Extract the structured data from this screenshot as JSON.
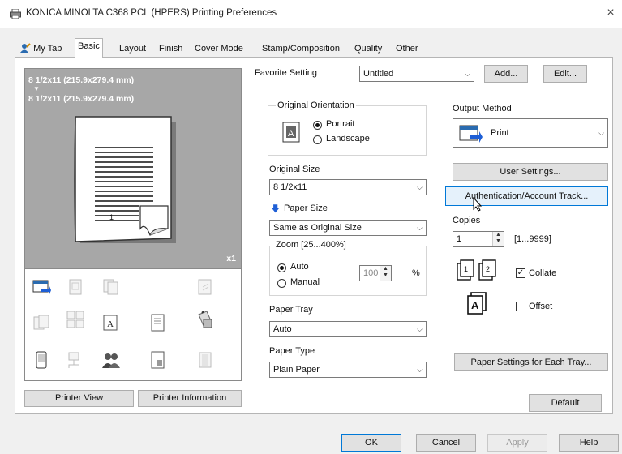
{
  "window": {
    "title": "KONICA MINOLTA C368 PCL (HPERS) Printing Preferences",
    "close": "×"
  },
  "tabs": [
    {
      "label": "My Tab"
    },
    {
      "label": "Basic"
    },
    {
      "label": "Layout"
    },
    {
      "label": "Finish"
    },
    {
      "label": "Cover Mode"
    },
    {
      "label": "Stamp/Composition"
    },
    {
      "label": "Quality"
    },
    {
      "label": "Other"
    }
  ],
  "preview": {
    "line1": "8 1/2x11 (215.9x279.4 mm)",
    "arrow": "▼",
    "line2": "8 1/2x11 (215.9x279.4 mm)",
    "page_count": "x1",
    "page_number": "1"
  },
  "left_buttons": {
    "printer_view": "Printer View",
    "printer_information": "Printer Information"
  },
  "favorite": {
    "label": "Favorite Setting",
    "value": "Untitled",
    "add": "Add...",
    "edit": "Edit..."
  },
  "orientation": {
    "group_label": "Original Orientation",
    "portrait": "Portrait",
    "landscape": "Landscape",
    "selected": "Portrait"
  },
  "original_size": {
    "label": "Original Size",
    "value": "8 1/2x11"
  },
  "paper_size": {
    "label": "Paper Size",
    "value": "Same as Original Size"
  },
  "zoom": {
    "group_label": "Zoom [25...400%]",
    "auto": "Auto",
    "manual": "Manual",
    "value": "100",
    "unit": "%",
    "selected": "Auto"
  },
  "paper_tray": {
    "label": "Paper Tray",
    "value": "Auto"
  },
  "paper_type": {
    "label": "Paper Type",
    "value": "Plain Paper"
  },
  "output": {
    "label": "Output Method",
    "value": "Print",
    "user_settings": "User Settings...",
    "auth": "Authentication/Account Track..."
  },
  "copies": {
    "label": "Copies",
    "value": "1",
    "range": "[1...9999]",
    "collate": "Collate",
    "collate_checked": true,
    "offset": "Offset",
    "offset_checked": false
  },
  "paper_settings_button": "Paper Settings for Each Tray...",
  "default_button": "Default",
  "dialog_buttons": {
    "ok": "OK",
    "cancel": "Cancel",
    "apply": "Apply",
    "help": "Help"
  },
  "colors": {
    "accent": "#0078d7",
    "preview_bg": "#a7a7a7",
    "paper_size_arrow": "#1e5fd6"
  }
}
